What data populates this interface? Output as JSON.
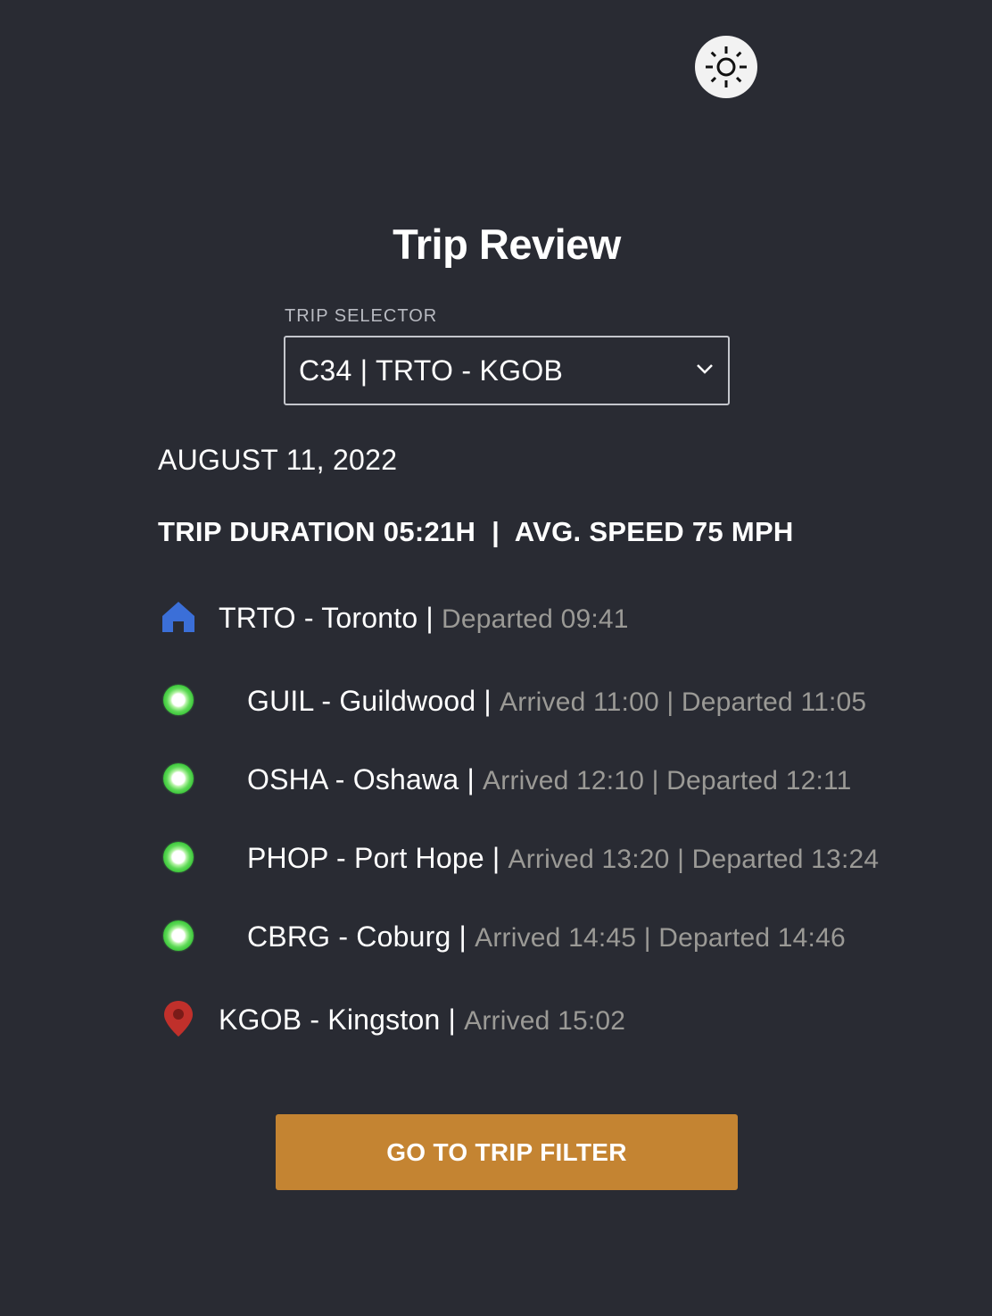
{
  "theme_toggle": {
    "icon": "sun-icon"
  },
  "header": {
    "title": "Trip Review"
  },
  "selector": {
    "label": "TRIP SELECTOR",
    "value": "C34 | TRTO - KGOB",
    "icon": "chevron-down-icon"
  },
  "trip": {
    "date": "AUGUST 11, 2022",
    "stats": "TRIP DURATION 05:21H  |  AVG. SPEED 75 MPH"
  },
  "stops": [
    {
      "name": "TRTO - Toronto |",
      "detail": "Departed 09:41",
      "icon": "home-icon"
    },
    {
      "name": "GUIL - Guildwood |",
      "detail": "Arrived 11:00 | Departed 11:05",
      "icon": "green-dot-icon"
    },
    {
      "name": "OSHA - Oshawa |",
      "detail": "Arrived 12:10 | Departed 12:11",
      "icon": "green-dot-icon"
    },
    {
      "name": "PHOP - Port Hope |",
      "detail": "Arrived 13:20 | Departed 13:24",
      "icon": "green-dot-icon"
    },
    {
      "name": "CBRG - Coburg |",
      "detail": "Arrived 14:45 | Departed 14:46",
      "icon": "green-dot-icon"
    },
    {
      "name": "KGOB - Kingston |",
      "detail": "Arrived 15:02",
      "icon": "location-pin-icon"
    }
  ],
  "button": {
    "label": "GO TO TRIP FILTER"
  },
  "colors": {
    "background": "#292b33",
    "accent_button": "#c48432",
    "home_icon": "#3b6fd8",
    "pin_icon": "#c0302b",
    "dot_green": "#4fcf45",
    "muted_text": "#9b9a96"
  }
}
